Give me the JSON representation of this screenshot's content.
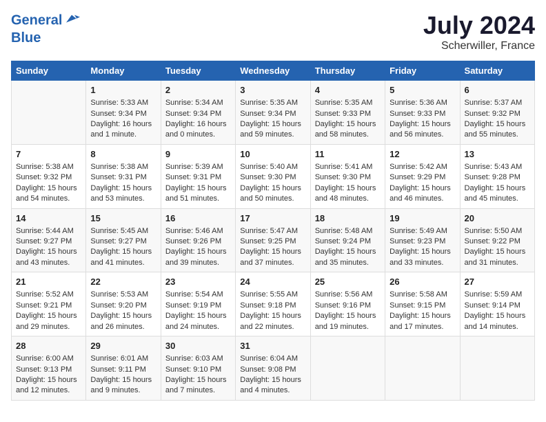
{
  "logo": {
    "line1": "General",
    "line2": "Blue"
  },
  "title": "July 2024",
  "location": "Scherwiller, France",
  "days_of_week": [
    "Sunday",
    "Monday",
    "Tuesday",
    "Wednesday",
    "Thursday",
    "Friday",
    "Saturday"
  ],
  "weeks": [
    [
      {
        "day": "",
        "lines": []
      },
      {
        "day": "1",
        "lines": [
          "Sunrise: 5:33 AM",
          "Sunset: 9:34 PM",
          "Daylight: 16 hours",
          "and 1 minute."
        ]
      },
      {
        "day": "2",
        "lines": [
          "Sunrise: 5:34 AM",
          "Sunset: 9:34 PM",
          "Daylight: 16 hours",
          "and 0 minutes."
        ]
      },
      {
        "day": "3",
        "lines": [
          "Sunrise: 5:35 AM",
          "Sunset: 9:34 PM",
          "Daylight: 15 hours",
          "and 59 minutes."
        ]
      },
      {
        "day": "4",
        "lines": [
          "Sunrise: 5:35 AM",
          "Sunset: 9:33 PM",
          "Daylight: 15 hours",
          "and 58 minutes."
        ]
      },
      {
        "day": "5",
        "lines": [
          "Sunrise: 5:36 AM",
          "Sunset: 9:33 PM",
          "Daylight: 15 hours",
          "and 56 minutes."
        ]
      },
      {
        "day": "6",
        "lines": [
          "Sunrise: 5:37 AM",
          "Sunset: 9:32 PM",
          "Daylight: 15 hours",
          "and 55 minutes."
        ]
      }
    ],
    [
      {
        "day": "7",
        "lines": [
          "Sunrise: 5:38 AM",
          "Sunset: 9:32 PM",
          "Daylight: 15 hours",
          "and 54 minutes."
        ]
      },
      {
        "day": "8",
        "lines": [
          "Sunrise: 5:38 AM",
          "Sunset: 9:31 PM",
          "Daylight: 15 hours",
          "and 53 minutes."
        ]
      },
      {
        "day": "9",
        "lines": [
          "Sunrise: 5:39 AM",
          "Sunset: 9:31 PM",
          "Daylight: 15 hours",
          "and 51 minutes."
        ]
      },
      {
        "day": "10",
        "lines": [
          "Sunrise: 5:40 AM",
          "Sunset: 9:30 PM",
          "Daylight: 15 hours",
          "and 50 minutes."
        ]
      },
      {
        "day": "11",
        "lines": [
          "Sunrise: 5:41 AM",
          "Sunset: 9:30 PM",
          "Daylight: 15 hours",
          "and 48 minutes."
        ]
      },
      {
        "day": "12",
        "lines": [
          "Sunrise: 5:42 AM",
          "Sunset: 9:29 PM",
          "Daylight: 15 hours",
          "and 46 minutes."
        ]
      },
      {
        "day": "13",
        "lines": [
          "Sunrise: 5:43 AM",
          "Sunset: 9:28 PM",
          "Daylight: 15 hours",
          "and 45 minutes."
        ]
      }
    ],
    [
      {
        "day": "14",
        "lines": [
          "Sunrise: 5:44 AM",
          "Sunset: 9:27 PM",
          "Daylight: 15 hours",
          "and 43 minutes."
        ]
      },
      {
        "day": "15",
        "lines": [
          "Sunrise: 5:45 AM",
          "Sunset: 9:27 PM",
          "Daylight: 15 hours",
          "and 41 minutes."
        ]
      },
      {
        "day": "16",
        "lines": [
          "Sunrise: 5:46 AM",
          "Sunset: 9:26 PM",
          "Daylight: 15 hours",
          "and 39 minutes."
        ]
      },
      {
        "day": "17",
        "lines": [
          "Sunrise: 5:47 AM",
          "Sunset: 9:25 PM",
          "Daylight: 15 hours",
          "and 37 minutes."
        ]
      },
      {
        "day": "18",
        "lines": [
          "Sunrise: 5:48 AM",
          "Sunset: 9:24 PM",
          "Daylight: 15 hours",
          "and 35 minutes."
        ]
      },
      {
        "day": "19",
        "lines": [
          "Sunrise: 5:49 AM",
          "Sunset: 9:23 PM",
          "Daylight: 15 hours",
          "and 33 minutes."
        ]
      },
      {
        "day": "20",
        "lines": [
          "Sunrise: 5:50 AM",
          "Sunset: 9:22 PM",
          "Daylight: 15 hours",
          "and 31 minutes."
        ]
      }
    ],
    [
      {
        "day": "21",
        "lines": [
          "Sunrise: 5:52 AM",
          "Sunset: 9:21 PM",
          "Daylight: 15 hours",
          "and 29 minutes."
        ]
      },
      {
        "day": "22",
        "lines": [
          "Sunrise: 5:53 AM",
          "Sunset: 9:20 PM",
          "Daylight: 15 hours",
          "and 26 minutes."
        ]
      },
      {
        "day": "23",
        "lines": [
          "Sunrise: 5:54 AM",
          "Sunset: 9:19 PM",
          "Daylight: 15 hours",
          "and 24 minutes."
        ]
      },
      {
        "day": "24",
        "lines": [
          "Sunrise: 5:55 AM",
          "Sunset: 9:18 PM",
          "Daylight: 15 hours",
          "and 22 minutes."
        ]
      },
      {
        "day": "25",
        "lines": [
          "Sunrise: 5:56 AM",
          "Sunset: 9:16 PM",
          "Daylight: 15 hours",
          "and 19 minutes."
        ]
      },
      {
        "day": "26",
        "lines": [
          "Sunrise: 5:58 AM",
          "Sunset: 9:15 PM",
          "Daylight: 15 hours",
          "and 17 minutes."
        ]
      },
      {
        "day": "27",
        "lines": [
          "Sunrise: 5:59 AM",
          "Sunset: 9:14 PM",
          "Daylight: 15 hours",
          "and 14 minutes."
        ]
      }
    ],
    [
      {
        "day": "28",
        "lines": [
          "Sunrise: 6:00 AM",
          "Sunset: 9:13 PM",
          "Daylight: 15 hours",
          "and 12 minutes."
        ]
      },
      {
        "day": "29",
        "lines": [
          "Sunrise: 6:01 AM",
          "Sunset: 9:11 PM",
          "Daylight: 15 hours",
          "and 9 minutes."
        ]
      },
      {
        "day": "30",
        "lines": [
          "Sunrise: 6:03 AM",
          "Sunset: 9:10 PM",
          "Daylight: 15 hours",
          "and 7 minutes."
        ]
      },
      {
        "day": "31",
        "lines": [
          "Sunrise: 6:04 AM",
          "Sunset: 9:08 PM",
          "Daylight: 15 hours",
          "and 4 minutes."
        ]
      },
      {
        "day": "",
        "lines": []
      },
      {
        "day": "",
        "lines": []
      },
      {
        "day": "",
        "lines": []
      }
    ]
  ]
}
